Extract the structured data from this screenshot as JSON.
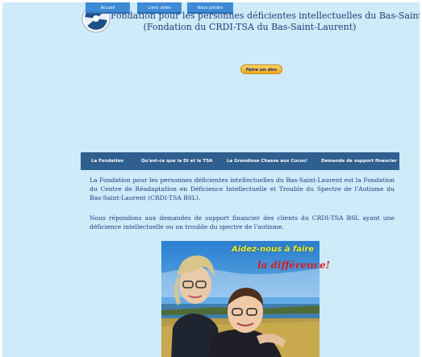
{
  "header": {
    "title_line1": "Fondation pour les personnes déficientes intellectuelles du Bas-Saint-Laurent",
    "title_line2": "(Fondation du CRDI-TSA du Bas-Saint-Laurent)"
  },
  "top_nav": {
    "items": [
      "Accueil",
      "Liens utiles",
      "Nous joindre"
    ],
    "donate_label": "Faire un don"
  },
  "main_nav": {
    "items": [
      "La Fondation",
      "Qu'est-ce que la DI et le TSA",
      "La Grandiose Chasse aux Cocos!",
      "Demande de support financier"
    ]
  },
  "content": {
    "paragraph1": "La Fondation pour les personnes déficientes intellectuelles du Bas-Saint-Laurent est la Fondation du Centre de Réadaptation en Déficience Intellectuelle et Trouble du Spectre de l'Autisme du Bas-Saint-Laurent (CRDI-TSA BSL).",
    "paragraph2": "Nous répondons aux demandes de support financier des clients du CRDI-TSA BSL ayant une déficience intellectuelle ou un trouble du spectre de l'autisme.",
    "photo_text1": "Aidez-nous à faire",
    "photo_text2": "la différence!"
  },
  "colors": {
    "page_bg": "#cfeaf8",
    "nav_bg": "#2f5f8f",
    "button_bg": "#3d8bd6",
    "text": "#1f3a7a",
    "donate": "#f2a61a"
  }
}
